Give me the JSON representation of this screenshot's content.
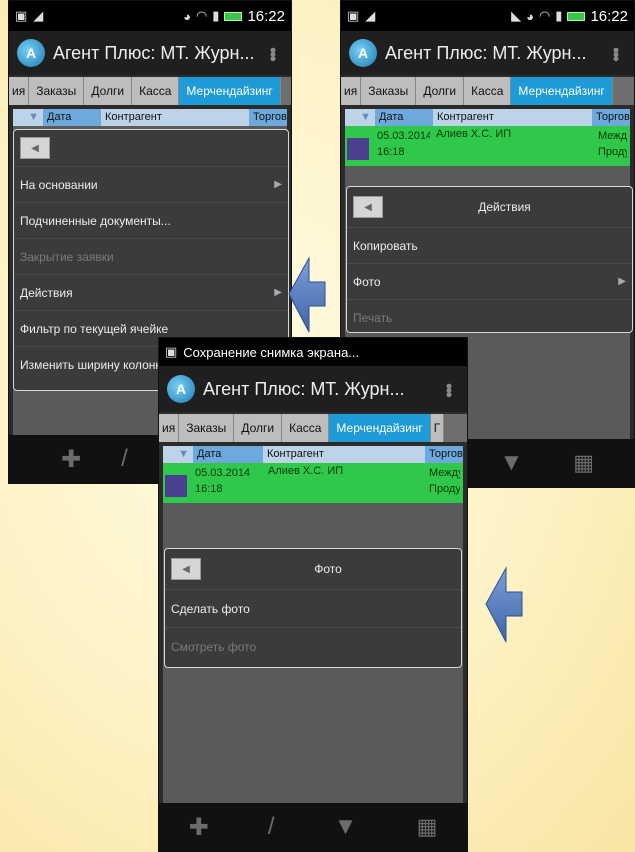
{
  "status_time": "16:22",
  "app_title": "Агент Плюс: МТ. Журн...",
  "tabs": {
    "edge_left": "ия",
    "orders": "Заказы",
    "debts": "Долги",
    "cash": "Касса",
    "merch": "Мерчендайзинг",
    "edge_right": "Г"
  },
  "grid": {
    "col_date": "Дата",
    "col_counterparty": "Контрагент",
    "col_trade": "Торгов",
    "row_date": "05.03.2014",
    "row_time": "16:18",
    "row_counterparty": "Алиев Х.С. ИП",
    "row_trade_1": "Между",
    "row_trade_2": "Проду"
  },
  "menu1": [
    {
      "label": "На основании",
      "disabled": false,
      "submenu": true
    },
    {
      "label": "Подчиненные документы...",
      "disabled": false,
      "submenu": false
    },
    {
      "label": "Закрытие заявки",
      "disabled": true,
      "submenu": false
    },
    {
      "label": "Действия",
      "disabled": false,
      "submenu": true
    },
    {
      "label": "Фильтр по текущей ячейке",
      "disabled": false,
      "submenu": false
    },
    {
      "label": "Изменить ширину колонки",
      "disabled": false,
      "submenu": false
    }
  ],
  "menu2": {
    "title": "Действия",
    "items": [
      {
        "label": "Копировать",
        "disabled": false
      },
      {
        "label": "Фото",
        "disabled": false
      },
      {
        "label": "Печать",
        "disabled": true
      }
    ]
  },
  "menu3": {
    "title": "Фото",
    "items": [
      {
        "label": "Сделать фото",
        "disabled": false
      },
      {
        "label": "Смотреть фото",
        "disabled": true
      }
    ]
  },
  "screenshot_notification": "Сохранение снимка экрана...",
  "colors": {
    "accent_tab": "#1e9ad6",
    "row_green": "#2fc84a",
    "arrow_blue": "#5b7fc0"
  }
}
